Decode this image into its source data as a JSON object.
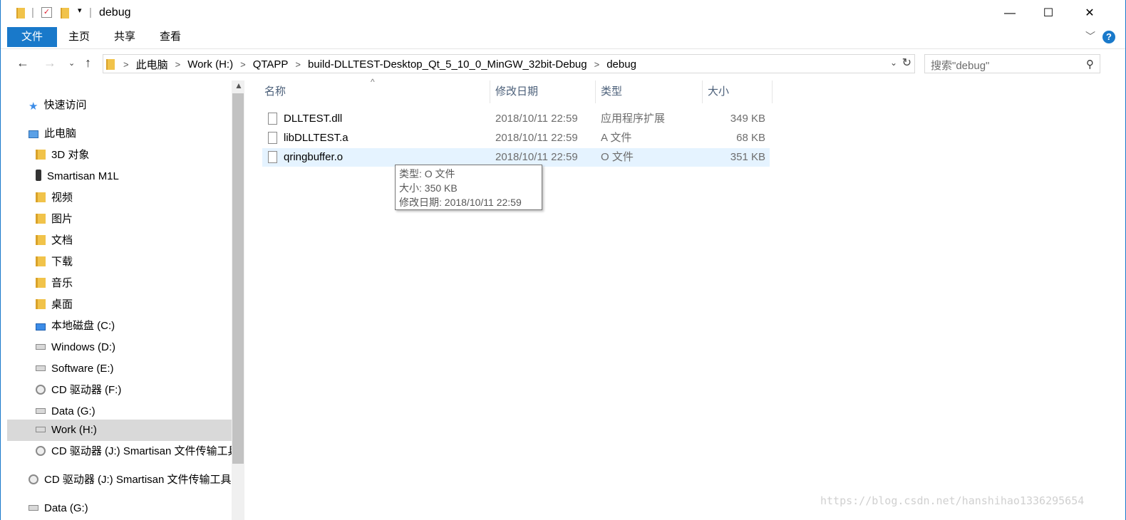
{
  "window": {
    "title": "debug",
    "close": "✕",
    "maximize": "☐",
    "minimize": "—"
  },
  "ribbon": {
    "file": "文件",
    "home": "主页",
    "share": "共享",
    "view": "查看",
    "help": "?"
  },
  "address": {
    "crumbs": [
      "此电脑",
      "Work (H:)",
      "QTAPP",
      "build-DLLTEST-Desktop_Qt_5_10_0_MinGW_32bit-Debug",
      "debug"
    ]
  },
  "search": {
    "placeholder": "搜索\"debug\""
  },
  "nav": {
    "quick_access": "快速访问",
    "this_pc": "此电脑",
    "items": [
      "3D 对象",
      "Smartisan M1L",
      "视频",
      "图片",
      "文档",
      "下载",
      "音乐",
      "桌面",
      "本地磁盘 (C:)",
      "Windows (D:)",
      "Software (E:)",
      "CD 驱动器 (F:)",
      "Data (G:)",
      "Work (H:)",
      "CD 驱动器 (J:) Smartisan 文件传输工具",
      "CD 驱动器 (J:) Smartisan 文件传输工具",
      "Data (G:)"
    ]
  },
  "columns": {
    "name": "名称",
    "modified": "修改日期",
    "type": "类型",
    "size": "大小"
  },
  "files": [
    {
      "name": "DLLTEST.dll",
      "modified": "2018/10/11 22:59",
      "type": "应用程序扩展",
      "size": "349 KB"
    },
    {
      "name": "libDLLTEST.a",
      "modified": "2018/10/11 22:59",
      "type": "A 文件",
      "size": "68 KB"
    },
    {
      "name": "qringbuffer.o",
      "modified": "2018/10/11 22:59",
      "type": "O 文件",
      "size": "351 KB"
    }
  ],
  "tooltip": {
    "type": "类型: O 文件",
    "size": "大小: 350 KB",
    "modified": "修改日期: 2018/10/11 22:59"
  },
  "watermark": "https://blog.csdn.net/hanshihao1336295654",
  "colors": {
    "accent": "#1979ca",
    "hover": "#e5f3ff",
    "selected": "#d9d9d9"
  }
}
